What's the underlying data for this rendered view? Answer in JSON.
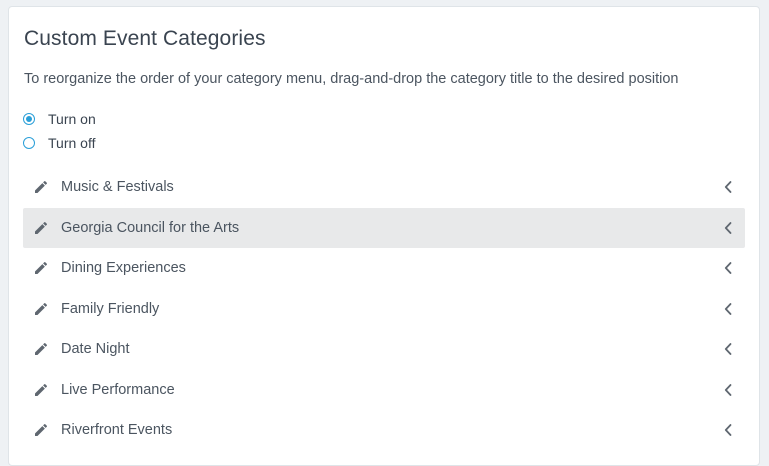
{
  "panel": {
    "title": "Custom Event Categories",
    "description": "To reorganize the order of your category menu, drag-and-drop the category title to the desired position"
  },
  "toggle": {
    "on_label": "Turn on",
    "off_label": "Turn off",
    "selected": "on"
  },
  "categories": [
    {
      "label": "Music & Festivals",
      "icon": "pencil-icon"
    },
    {
      "label": "Georgia Council for the Arts",
      "icon": "pencil-icon"
    },
    {
      "label": "Dining Experiences",
      "icon": "pencil-icon"
    },
    {
      "label": "Family Friendly",
      "icon": "pencil-icon"
    },
    {
      "label": "Date Night",
      "icon": "pencil-icon"
    },
    {
      "label": "Live Performance",
      "icon": "pencil-icon"
    },
    {
      "label": "Riverfront Events",
      "icon": "pencil-icon"
    }
  ],
  "colors": {
    "accent": "#2a9fd8",
    "hover_row": "#e8e9ea",
    "text": "#4b5560"
  }
}
